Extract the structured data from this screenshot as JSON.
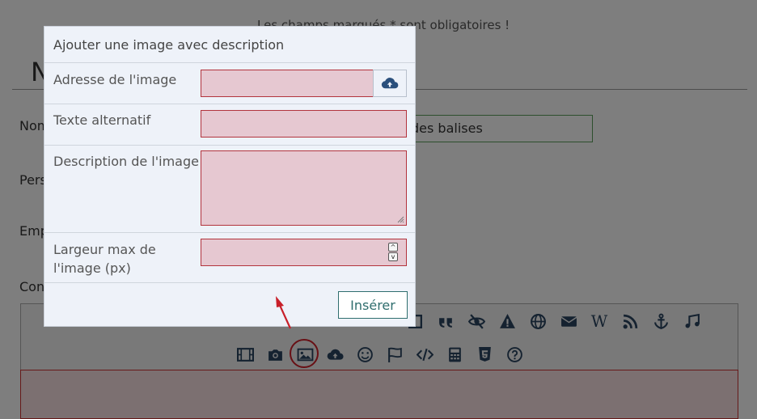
{
  "background": {
    "required_note": "Les champs marqués * sont obligatoires !",
    "title_partial": "N",
    "labels": {
      "name": "Nom",
      "person": "Pers",
      "employer": "Emp",
      "content": "Con"
    },
    "name_input_value": "des balises"
  },
  "modal": {
    "title": "Ajouter une image avec description",
    "fields": {
      "address_label": "Adresse de l'image",
      "alt_label": "Texte alternatif",
      "description_label": "Description de l'image",
      "width_label_line1": "Largeur max de",
      "width_label_line2": "l'image (px)"
    },
    "insert_label": "Insérer"
  },
  "toolbar": {
    "row1_icons": [
      "square-icon",
      "quote-icon",
      "eye-slash-icon",
      "warning-icon",
      "globe-icon",
      "envelope-icon",
      "wikipedia-icon",
      "rss-icon",
      "anchor-icon",
      "music-icon"
    ],
    "row1_wiki_label": "W",
    "row2_icons": [
      "film-icon",
      "camera-icon",
      "image-icon",
      "cloud-upload-icon",
      "smiley-icon",
      "flag-icon",
      "code-icon",
      "calculator-icon",
      "html5-icon",
      "help-icon"
    ]
  },
  "colors": {
    "accent": "#2f6e6e",
    "invalid_border": "#b3343d",
    "invalid_fill": "#e6c8d1",
    "highlight": "#d0202a"
  }
}
